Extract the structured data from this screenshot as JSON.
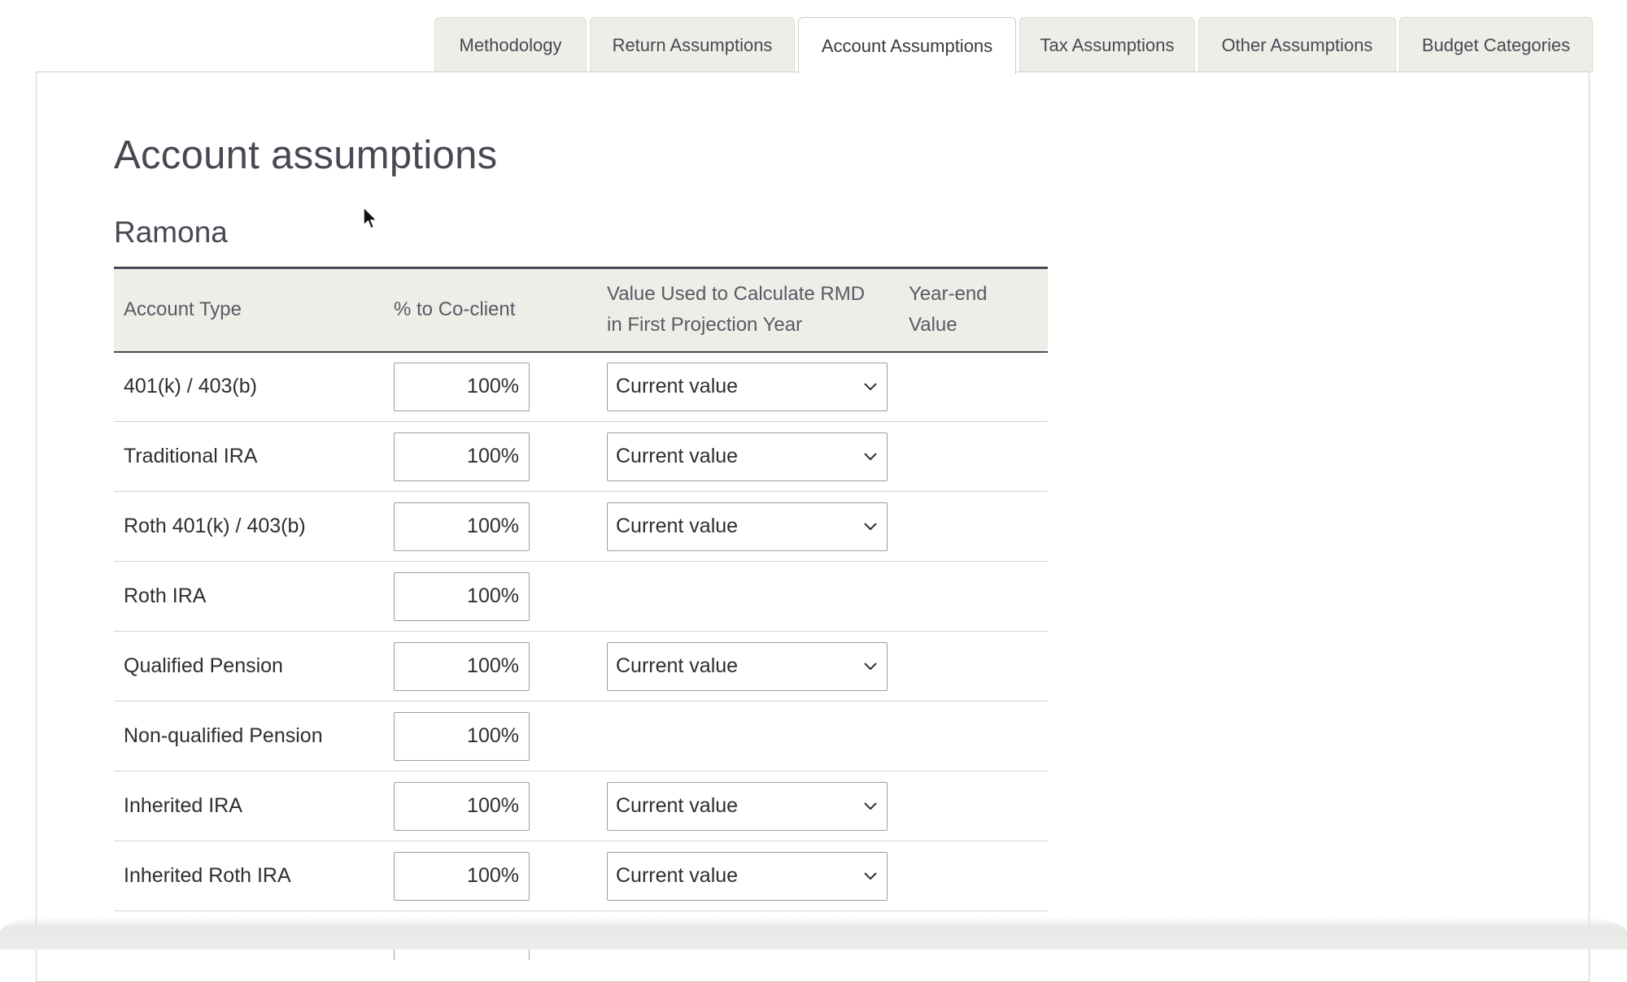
{
  "tabs": [
    {
      "label": "Methodology",
      "active": false
    },
    {
      "label": "Return Assumptions",
      "active": false
    },
    {
      "label": "Account Assumptions",
      "active": true
    },
    {
      "label": "Tax Assumptions",
      "active": false
    },
    {
      "label": "Other Assumptions",
      "active": false
    },
    {
      "label": "Budget Categories",
      "active": false
    }
  ],
  "page": {
    "title": "Account assumptions",
    "person_name": "Ramona"
  },
  "table": {
    "headers": {
      "account_type": "Account Type",
      "pct_to_coclient": "% to Co-client",
      "rmd_value_line1": "Value Used to Calculate RMD",
      "rmd_value_line2": "in First Projection Year",
      "year_end_value": "Year-end Value"
    },
    "rows": [
      {
        "account_type": "401(k) / 403(b)",
        "pct": "100%",
        "rmd": "Current value"
      },
      {
        "account_type": "Traditional IRA",
        "pct": "100%",
        "rmd": "Current value"
      },
      {
        "account_type": "Roth 401(k) / 403(b)",
        "pct": "100%",
        "rmd": "Current value"
      },
      {
        "account_type": "Roth IRA",
        "pct": "100%",
        "rmd": null
      },
      {
        "account_type": "Qualified Pension",
        "pct": "100%",
        "rmd": "Current value"
      },
      {
        "account_type": "Non-qualified Pension",
        "pct": "100%",
        "rmd": null
      },
      {
        "account_type": "Inherited IRA",
        "pct": "100%",
        "rmd": "Current value"
      },
      {
        "account_type": "Inherited Roth IRA",
        "pct": "100%",
        "rmd": "Current value"
      }
    ]
  },
  "colors": {
    "header_bg": "#eeede8",
    "header_rule": "#4d4b55",
    "tab_bg": "#eeede8"
  },
  "icons": {
    "select_chevron": "chevron-down-icon",
    "pointer": "mouse-cursor-icon"
  }
}
